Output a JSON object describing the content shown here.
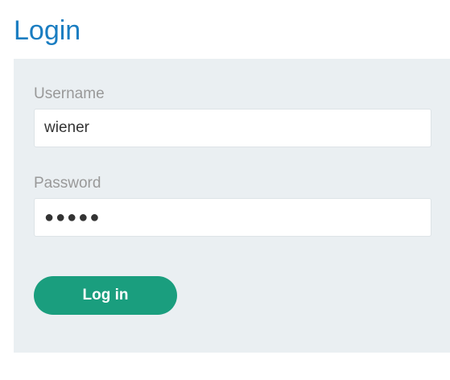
{
  "page": {
    "title": "Login"
  },
  "form": {
    "username": {
      "label": "Username",
      "value": "wiener"
    },
    "password": {
      "label": "Password",
      "value": "●●●●●"
    },
    "submit_label": "Log in"
  },
  "colors": {
    "title": "#1a7dc1",
    "panel_background": "#eaeff2",
    "button": "#1a9e7e",
    "label": "#999999"
  }
}
